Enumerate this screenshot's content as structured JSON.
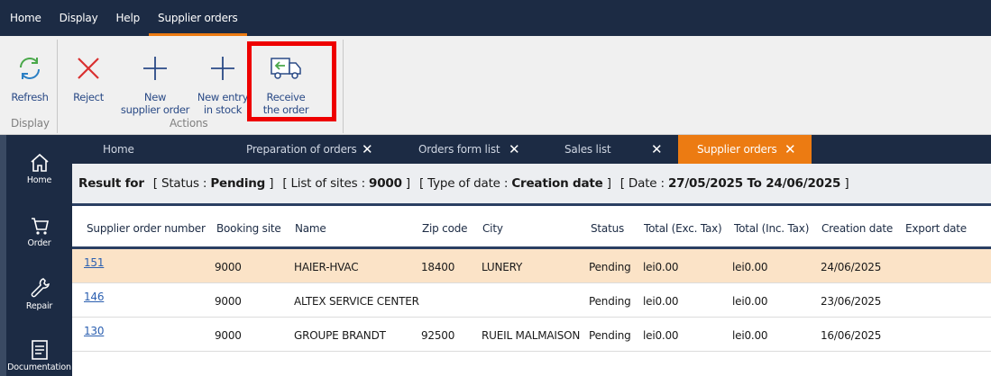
{
  "menu": {
    "items": [
      "Home",
      "Display",
      "Help",
      "Supplier orders"
    ],
    "active_index": 3
  },
  "ribbon": {
    "refresh": "Refresh",
    "reject": "Reject",
    "new_supplier_order": [
      "New",
      "supplier order"
    ],
    "new_entry_in_stock": [
      "New entry",
      "in stock"
    ],
    "receive_the_order": [
      "Receive",
      "the order"
    ],
    "group_display": "Display",
    "group_actions": "Actions"
  },
  "sidebar": {
    "items": [
      "Home",
      "Order",
      "Repair",
      "Documentation"
    ]
  },
  "tabs": {
    "items": [
      {
        "label": "Home",
        "closable": false
      },
      {
        "label": "Preparation of orders",
        "closable": true
      },
      {
        "label": "Orders form list",
        "closable": true
      },
      {
        "label": "Sales list",
        "closable": true
      },
      {
        "label": "Supplier orders",
        "closable": true
      }
    ],
    "active_index": 4,
    "close_glyph": "✕"
  },
  "result": {
    "result_for": "Result for",
    "status_label": "[ Status :",
    "status_value": "Pending",
    "status_close": "]",
    "sites_label": "[ List of sites :",
    "sites_value": "9000",
    "sites_close": "]",
    "datetype_label": "[ Type of date :",
    "datetype_value": "Creation date",
    "datetype_close": "]",
    "date_label": "[ Date :",
    "date_value": "27/05/2025 To 24/06/2025",
    "date_close": "]"
  },
  "table": {
    "columns": [
      "Supplier order number",
      "Booking site",
      "Name",
      "Zip code",
      "City",
      "Status",
      "Total (Exc. Tax)",
      "Total (Inc. Tax)",
      "Creation date",
      "Export date"
    ],
    "rows": [
      {
        "number": "151",
        "site": "9000",
        "name": "HAIER-HVAC",
        "zip": "18400",
        "city": "LUNERY",
        "status": "Pending",
        "total_exc": "lei0.00",
        "total_inc": "lei0.00",
        "created": "24/06/2025",
        "exported": "",
        "selected": true
      },
      {
        "number": "146",
        "site": "9000",
        "name": "ALTEX SERVICE CENTER",
        "zip": "",
        "city": "",
        "status": "Pending",
        "total_exc": "lei0.00",
        "total_inc": "lei0.00",
        "created": "23/06/2025",
        "exported": "",
        "selected": false
      },
      {
        "number": "130",
        "site": "9000",
        "name": "GROUPE BRANDT",
        "zip": "92500",
        "city": "RUEIL MALMAISON",
        "status": "Pending",
        "total_exc": "lei0.00",
        "total_inc": "lei0.00",
        "created": "16/06/2025",
        "exported": "",
        "selected": false
      }
    ]
  },
  "colors": {
    "navy": "#1c2b44",
    "accent_orange": "#ec7b12",
    "selected_row": "#fbe3c7",
    "highlight_red": "#ee0000"
  }
}
